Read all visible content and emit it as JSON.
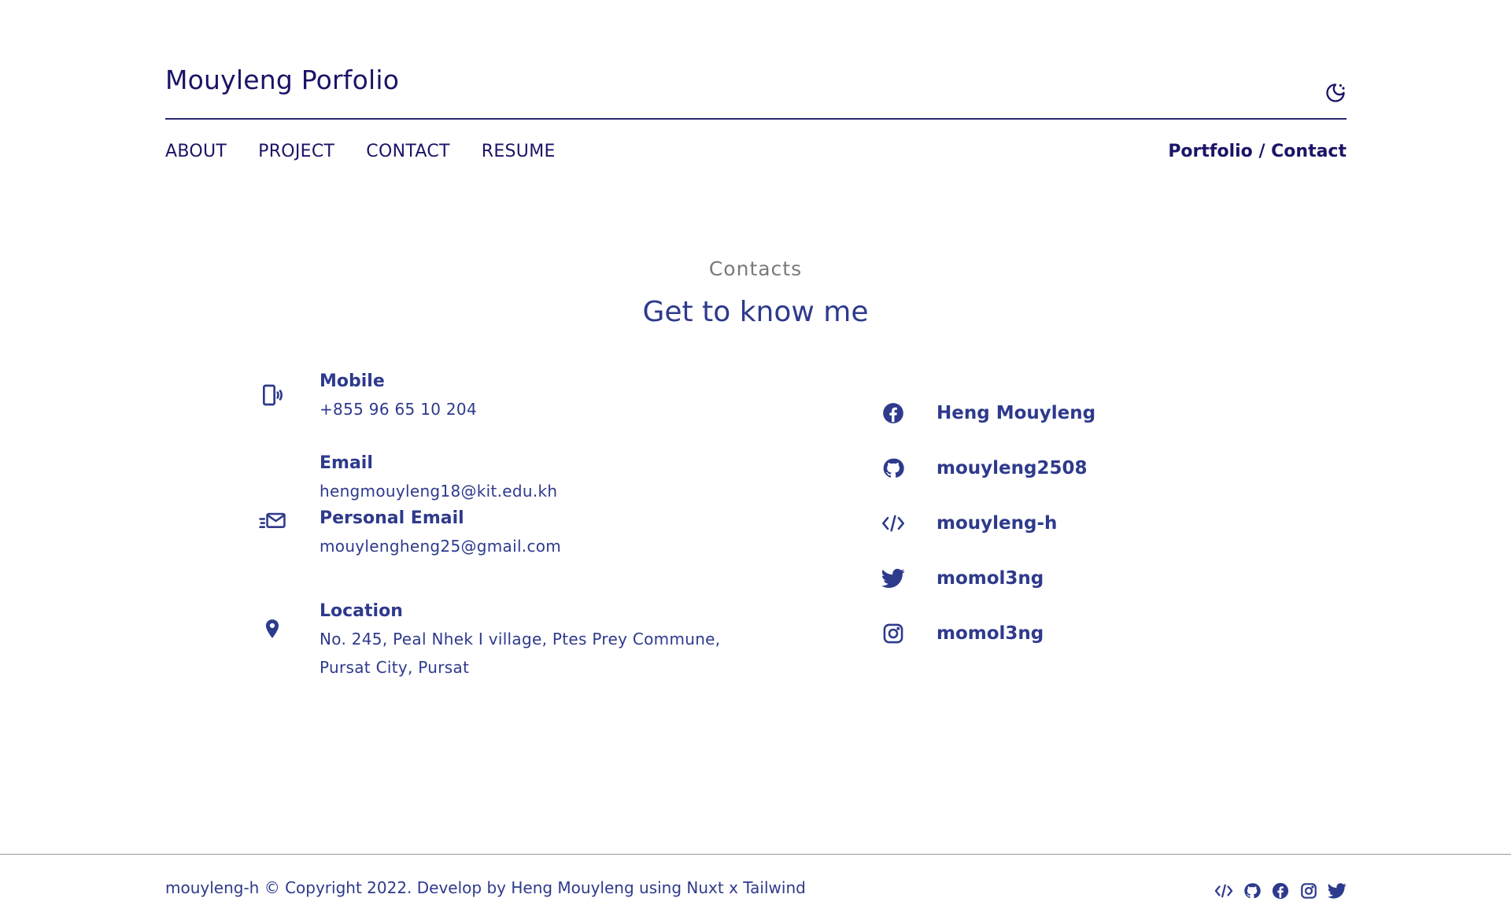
{
  "header": {
    "brand": "Mouyleng Porfolio",
    "theme_icon": "moon-stars-icon"
  },
  "nav": {
    "links": [
      "ABOUT",
      "PROJECT",
      "CONTACT",
      "RESUME"
    ],
    "breadcrumb": "Portfolio / Contact"
  },
  "section": {
    "kicker": "Contacts",
    "title": "Get to know me"
  },
  "contacts": {
    "mobile": {
      "label": "Mobile",
      "value": "+855 96 65 10 204",
      "icon": "mobile-phone-icon"
    },
    "email": {
      "label": "Email",
      "value": "hengmouyleng18@kit.edu.kh",
      "icon": "fast-mail-icon"
    },
    "personal_email": {
      "label": "Personal Email",
      "value": "mouylengheng25@gmail.com"
    },
    "location": {
      "label": "Location",
      "line1": "No. 245, Peal Nhek I village, Ptes Prey Commune,",
      "line2": "Pursat City, Pursat",
      "icon": "map-pin-icon"
    }
  },
  "socials": [
    {
      "label": "Heng Mouyleng",
      "icon": "facebook-icon"
    },
    {
      "label": "mouyleng2508",
      "icon": "github-icon"
    },
    {
      "label": "mouyleng-h",
      "icon": "code-icon"
    },
    {
      "label": "momol3ng",
      "icon": "twitter-icon"
    },
    {
      "label": "momol3ng",
      "icon": "instagram-icon"
    }
  ],
  "footer": {
    "text": "mouyleng-h © Copyright 2022. Develop by Heng Mouyleng using Nuxt x Tailwind",
    "icons": [
      "code-icon",
      "github-icon",
      "facebook-icon",
      "instagram-icon",
      "twitter-icon"
    ]
  },
  "colors": {
    "primary": "#2e3a8c",
    "brand": "#1a1466",
    "muted": "#7a7a7a"
  }
}
